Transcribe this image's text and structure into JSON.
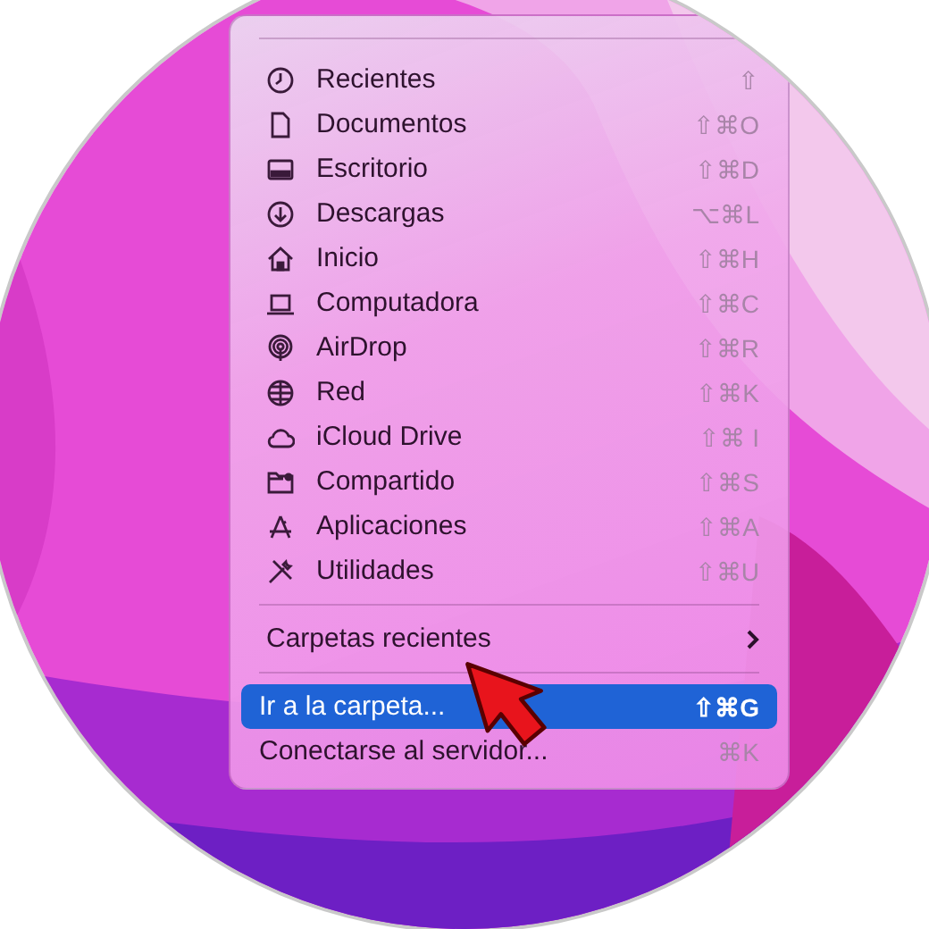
{
  "menu": {
    "places": [
      {
        "label": "Recientes",
        "shortcut": "⇧"
      },
      {
        "label": "Documentos",
        "shortcut": "⇧⌘O"
      },
      {
        "label": "Escritorio",
        "shortcut": "⇧⌘D"
      },
      {
        "label": "Descargas",
        "shortcut": "⌥⌘L"
      },
      {
        "label": "Inicio",
        "shortcut": "⇧⌘H"
      },
      {
        "label": "Computadora",
        "shortcut": "⇧⌘C"
      },
      {
        "label": "AirDrop",
        "shortcut": "⇧⌘R"
      },
      {
        "label": "Red",
        "shortcut": "⇧⌘K"
      },
      {
        "label": "iCloud Drive",
        "shortcut": "⇧⌘ I"
      },
      {
        "label": "Compartido",
        "shortcut": "⇧⌘S"
      },
      {
        "label": "Aplicaciones",
        "shortcut": "⇧⌘A"
      },
      {
        "label": "Utilidades",
        "shortcut": "⇧⌘U"
      }
    ],
    "submenus": [
      {
        "label": "Carpetas recientes",
        "has_submenu": true
      }
    ],
    "actions": [
      {
        "label": "Ir a la carpeta...",
        "shortcut": "⇧⌘G",
        "selected": true
      },
      {
        "label": "Conectarse al servidor...",
        "shortcut": "⌘K",
        "selected": false
      }
    ]
  }
}
